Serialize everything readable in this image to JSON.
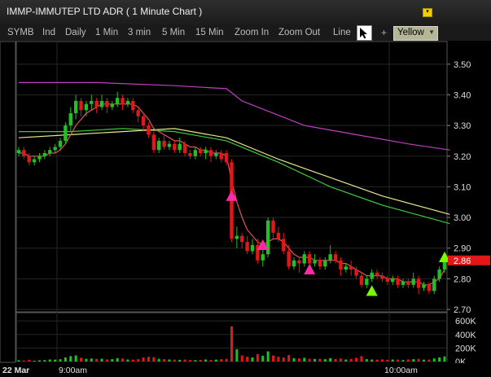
{
  "window": {
    "title": "IMMP-IMMUTEP LTD ADR ( 1 Minute Chart )",
    "menu_icon": "chevron-down-icon"
  },
  "toolbar": {
    "items": [
      "SYMB",
      "Ind",
      "Daily",
      "1 Min",
      "3 min",
      "5 Min",
      "15 Min",
      "Zoom In",
      "Zoom Out",
      "Line"
    ],
    "cursor_icon": "cursor-arrow-icon",
    "plus_label": "+",
    "color_selected": "Yellow"
  },
  "colors": {
    "up": "#22c022",
    "down": "#e01818",
    "ma_fast": "#e05555",
    "ma_mid": "#e8e890",
    "ma_slow": "#3cc83c",
    "ma_long": "#c040c0",
    "grid": "#262626"
  },
  "chart_data": {
    "type": "candlestick",
    "price_axis": {
      "ticks": [
        "3.50",
        "3.40",
        "3.30",
        "3.20",
        "3.10",
        "3.00",
        "2.90",
        "2.80",
        "2.70"
      ],
      "range": [
        2.7,
        3.55
      ],
      "last_price_label": "2.86"
    },
    "volume_axis": {
      "ticks": [
        "600K",
        "400K",
        "200K",
        "0K"
      ],
      "range": [
        0,
        650000
      ]
    },
    "x_labels": {
      "date": "22 Mar",
      "t1": "9:00am",
      "t2": "10:00am"
    },
    "candles": [
      [
        3.21,
        3.22,
        3.2,
        3.23
      ],
      [
        3.22,
        3.2,
        3.19,
        3.23
      ],
      [
        3.2,
        3.18,
        3.17,
        3.21
      ],
      [
        3.18,
        3.19,
        3.17,
        3.2
      ],
      [
        3.19,
        3.2,
        3.18,
        3.21
      ],
      [
        3.2,
        3.21,
        3.19,
        3.22
      ],
      [
        3.21,
        3.22,
        3.2,
        3.23
      ],
      [
        3.22,
        3.23,
        3.21,
        3.24
      ],
      [
        3.23,
        3.25,
        3.22,
        3.26
      ],
      [
        3.25,
        3.3,
        3.24,
        3.31
      ],
      [
        3.3,
        3.34,
        3.28,
        3.36
      ],
      [
        3.34,
        3.38,
        3.32,
        3.4
      ],
      [
        3.38,
        3.35,
        3.33,
        3.39
      ],
      [
        3.35,
        3.37,
        3.33,
        3.38
      ],
      [
        3.37,
        3.38,
        3.35,
        3.4
      ],
      [
        3.38,
        3.36,
        3.34,
        3.39
      ],
      [
        3.36,
        3.38,
        3.35,
        3.4
      ],
      [
        3.38,
        3.36,
        3.34,
        3.39
      ],
      [
        3.36,
        3.37,
        3.35,
        3.38
      ],
      [
        3.37,
        3.39,
        3.36,
        3.41
      ],
      [
        3.39,
        3.37,
        3.35,
        3.4
      ],
      [
        3.37,
        3.38,
        3.36,
        3.39
      ],
      [
        3.38,
        3.35,
        3.34,
        3.39
      ],
      [
        3.35,
        3.33,
        3.31,
        3.36
      ],
      [
        3.33,
        3.3,
        3.28,
        3.34
      ],
      [
        3.3,
        3.27,
        3.26,
        3.31
      ],
      [
        3.27,
        3.22,
        3.21,
        3.28
      ],
      [
        3.22,
        3.25,
        3.21,
        3.26
      ],
      [
        3.25,
        3.23,
        3.22,
        3.27
      ],
      [
        3.23,
        3.24,
        3.22,
        3.25
      ],
      [
        3.24,
        3.22,
        3.21,
        3.25
      ],
      [
        3.22,
        3.24,
        3.21,
        3.26
      ],
      [
        3.24,
        3.21,
        3.2,
        3.25
      ],
      [
        3.21,
        3.2,
        3.19,
        3.22
      ],
      [
        3.2,
        3.22,
        3.19,
        3.23
      ],
      [
        3.22,
        3.21,
        3.2,
        3.23
      ],
      [
        3.21,
        3.22,
        3.19,
        3.23
      ],
      [
        3.22,
        3.2,
        3.18,
        3.23
      ],
      [
        3.2,
        3.21,
        3.19,
        3.22
      ],
      [
        3.21,
        3.19,
        3.18,
        3.22
      ],
      [
        3.21,
        3.18,
        3.17,
        3.22
      ],
      [
        3.18,
        2.93,
        2.92,
        3.19
      ],
      [
        2.93,
        2.94,
        2.9,
        2.97
      ],
      [
        2.94,
        2.92,
        2.9,
        2.95
      ],
      [
        2.92,
        2.89,
        2.88,
        2.94
      ],
      [
        2.89,
        2.91,
        2.88,
        2.93
      ],
      [
        2.91,
        2.86,
        2.85,
        2.93
      ],
      [
        2.86,
        2.88,
        2.84,
        2.9
      ],
      [
        2.88,
        2.99,
        2.87,
        3.0
      ],
      [
        2.99,
        2.95,
        2.93,
        3.0
      ],
      [
        2.95,
        2.93,
        2.92,
        2.97
      ],
      [
        2.93,
        2.89,
        2.88,
        2.95
      ],
      [
        2.89,
        2.84,
        2.83,
        2.91
      ],
      [
        2.84,
        2.86,
        2.83,
        2.87
      ],
      [
        2.86,
        2.85,
        2.82,
        2.87
      ],
      [
        2.85,
        2.88,
        2.84,
        2.89
      ],
      [
        2.88,
        2.85,
        2.84,
        2.89
      ],
      [
        2.85,
        2.86,
        2.84,
        2.88
      ],
      [
        2.86,
        2.84,
        2.83,
        2.87
      ],
      [
        2.84,
        2.86,
        2.83,
        2.87
      ],
      [
        2.86,
        2.88,
        2.85,
        2.91
      ],
      [
        2.88,
        2.86,
        2.85,
        2.89
      ],
      [
        2.86,
        2.83,
        2.81,
        2.87
      ],
      [
        2.83,
        2.84,
        2.82,
        2.85
      ],
      [
        2.84,
        2.83,
        2.81,
        2.86
      ],
      [
        2.83,
        2.81,
        2.8,
        2.84
      ],
      [
        2.81,
        2.78,
        2.77,
        2.82
      ],
      [
        2.78,
        2.8,
        2.77,
        2.81
      ],
      [
        2.8,
        2.82,
        2.79,
        2.83
      ],
      [
        2.82,
        2.81,
        2.8,
        2.83
      ],
      [
        2.81,
        2.8,
        2.79,
        2.82
      ],
      [
        2.8,
        2.79,
        2.78,
        2.81
      ],
      [
        2.79,
        2.8,
        2.78,
        2.81
      ],
      [
        2.8,
        2.78,
        2.77,
        2.81
      ],
      [
        2.78,
        2.79,
        2.77,
        2.8
      ],
      [
        2.79,
        2.78,
        2.77,
        2.8
      ],
      [
        2.78,
        2.8,
        2.77,
        2.82
      ],
      [
        2.8,
        2.77,
        2.75,
        2.81
      ],
      [
        2.77,
        2.78,
        2.76,
        2.79
      ],
      [
        2.78,
        2.76,
        2.75,
        2.79
      ],
      [
        2.76,
        2.8,
        2.75,
        2.81
      ],
      [
        2.8,
        2.83,
        2.79,
        2.84
      ],
      [
        2.83,
        2.86,
        2.82,
        2.87
      ]
    ],
    "volumes": [
      20,
      15,
      25,
      12,
      18,
      22,
      30,
      28,
      35,
      60,
      80,
      90,
      55,
      40,
      45,
      38,
      42,
      30,
      35,
      50,
      45,
      30,
      28,
      35,
      60,
      70,
      65,
      40,
      35,
      30,
      28,
      25,
      30,
      22,
      20,
      25,
      30,
      22,
      28,
      35,
      40,
      520,
      180,
      90,
      70,
      60,
      110,
      85,
      150,
      90,
      70,
      60,
      95,
      50,
      45,
      55,
      40,
      38,
      42,
      35,
      50,
      38,
      45,
      30,
      40,
      55,
      80,
      35,
      30,
      28,
      32,
      25,
      30,
      28,
      22,
      30,
      35,
      40,
      28,
      30,
      45,
      60,
      75
    ],
    "ma_fast": [
      3.21,
      3.21,
      3.2,
      3.2,
      3.2,
      3.2,
      3.21,
      3.21,
      3.22,
      3.24,
      3.27,
      3.3,
      3.32,
      3.34,
      3.35,
      3.36,
      3.37,
      3.37,
      3.37,
      3.37,
      3.37,
      3.37,
      3.37,
      3.36,
      3.34,
      3.32,
      3.29,
      3.28,
      3.27,
      3.26,
      3.25,
      3.25,
      3.24,
      3.23,
      3.23,
      3.22,
      3.22,
      3.21,
      3.21,
      3.21,
      3.2,
      3.12,
      3.05,
      3.0,
      2.96,
      2.94,
      2.92,
      2.91,
      2.92,
      2.93,
      2.93,
      2.92,
      2.9,
      2.88,
      2.87,
      2.87,
      2.87,
      2.86,
      2.86,
      2.86,
      2.86,
      2.86,
      2.85,
      2.85,
      2.84,
      2.83,
      2.82,
      2.81,
      2.81,
      2.81,
      2.81,
      2.8,
      2.8,
      2.8,
      2.79,
      2.79,
      2.79,
      2.79,
      2.78,
      2.78,
      2.79,
      2.8,
      2.83
    ],
    "ma_mid_points": [
      [
        0,
        3.26
      ],
      [
        10,
        3.27
      ],
      [
        20,
        3.28
      ],
      [
        30,
        3.29
      ],
      [
        40,
        3.26
      ],
      [
        50,
        3.19
      ],
      [
        60,
        3.13
      ],
      [
        70,
        3.07
      ],
      [
        83,
        3.01
      ]
    ],
    "ma_slow_points": [
      [
        0,
        3.28
      ],
      [
        10,
        3.28
      ],
      [
        20,
        3.29
      ],
      [
        30,
        3.28
      ],
      [
        40,
        3.25
      ],
      [
        50,
        3.18
      ],
      [
        60,
        3.1
      ],
      [
        70,
        3.04
      ],
      [
        83,
        2.98
      ]
    ],
    "ma_long_points": [
      [
        0,
        3.44
      ],
      [
        15,
        3.44
      ],
      [
        30,
        3.43
      ],
      [
        40,
        3.42
      ],
      [
        43,
        3.38
      ],
      [
        55,
        3.3
      ],
      [
        65,
        3.27
      ],
      [
        75,
        3.24
      ],
      [
        83,
        3.22
      ]
    ],
    "markers": [
      {
        "index": 41,
        "price": 3.07,
        "kind": "up",
        "color": "#ff2aa8"
      },
      {
        "index": 47,
        "price": 2.91,
        "kind": "up",
        "color": "#ff2aa8"
      },
      {
        "index": 56,
        "price": 2.83,
        "kind": "up",
        "color": "#ff2aa8"
      },
      {
        "index": 68,
        "price": 2.76,
        "kind": "up",
        "color": "#77ff00"
      },
      {
        "index": 82,
        "price": 2.87,
        "kind": "up",
        "color": "#77ff00"
      }
    ]
  }
}
